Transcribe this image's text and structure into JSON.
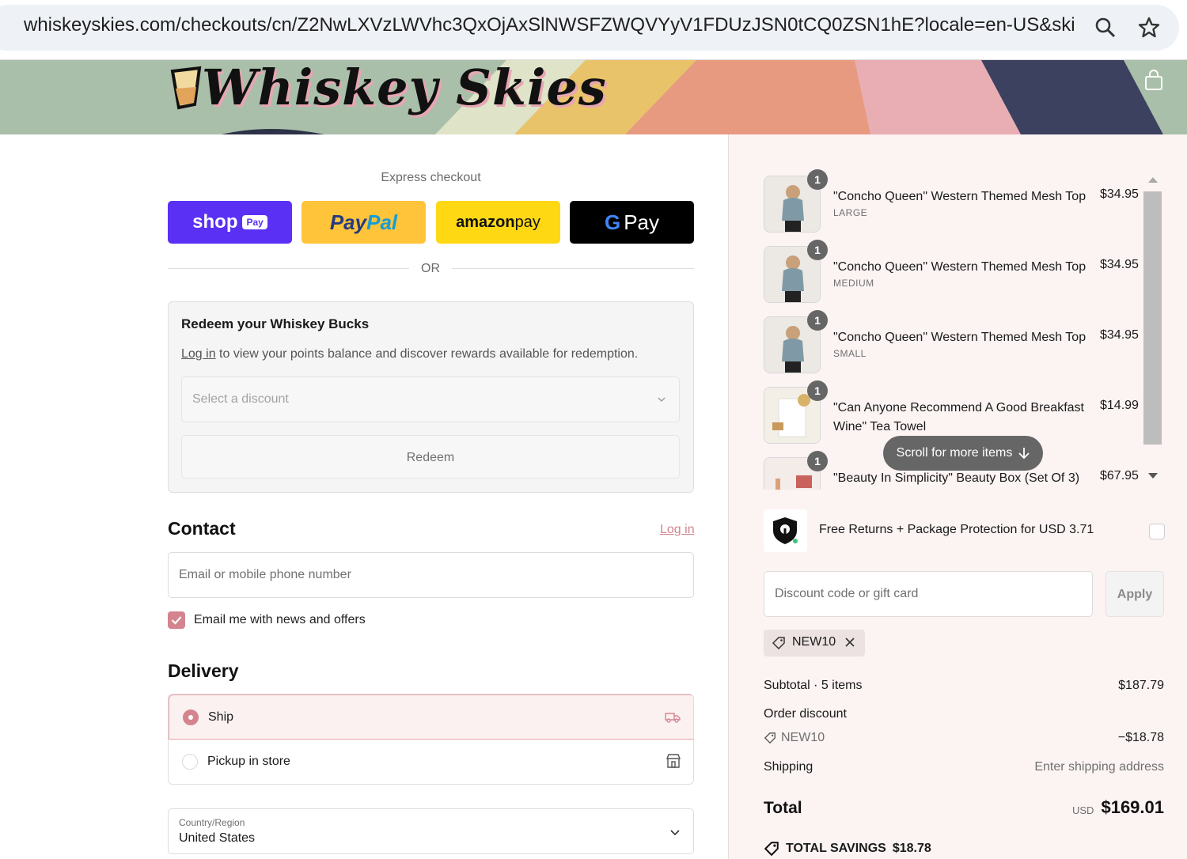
{
  "browser": {
    "url": "whiskeyskies.com/checkouts/cn/Z2NwLXVzLWVhc3QxOjAxSlNWSFZWQVYyV1FDUzJSN0tCQ0ZSN1hE?locale=en-US&skip_s...",
    "edge_char": "s"
  },
  "brand": {
    "name": "Whiskey Skies"
  },
  "express": {
    "title": "Express checkout",
    "shop_label": "shop",
    "shop_tag": "Pay",
    "paypal_a": "Pay",
    "paypal_b": "Pal",
    "amazon_a": "amazon",
    "amazon_b": " pay",
    "gpay_g": "G",
    "gpay_label": "Pay",
    "or": "OR"
  },
  "redeem": {
    "title": "Redeem your Whiskey Bucks",
    "login_link": "Log in",
    "desc": " to view your points balance and discover rewards available for redemption.",
    "select_placeholder": "Select a discount",
    "button": "Redeem"
  },
  "contact": {
    "title": "Contact",
    "login": "Log in",
    "email_placeholder": "Email or mobile phone number",
    "newsletter_label": "Email me with news and offers",
    "newsletter_checked": true
  },
  "delivery": {
    "title": "Delivery",
    "options": [
      {
        "label": "Ship",
        "selected": true
      },
      {
        "label": "Pickup in store",
        "selected": false
      }
    ],
    "country_label": "Country/Region",
    "country_value": "United States"
  },
  "cart": {
    "items": [
      {
        "qty": "1",
        "name": "\"Concho Queen\" Western Themed Mesh Top",
        "variant": "LARGE",
        "price": "$34.95"
      },
      {
        "qty": "1",
        "name": "\"Concho Queen\" Western Themed Mesh Top",
        "variant": "MEDIUM",
        "price": "$34.95"
      },
      {
        "qty": "1",
        "name": "\"Concho Queen\" Western Themed Mesh Top",
        "variant": "SMALL",
        "price": "$34.95"
      },
      {
        "qty": "1",
        "name": "\"Can Anyone Recommend A Good Breakfast Wine\" Tea Towel",
        "variant": "",
        "price": "$14.99"
      },
      {
        "qty": "1",
        "name": "\"Beauty In Simplicity\" Beauty Box (Set Of 3)",
        "variant": "",
        "price": "$67.95"
      }
    ],
    "scroll_hint": "Scroll for more items"
  },
  "protection": {
    "label": "Free Returns + Package Protection for USD 3.71",
    "checked": false
  },
  "discount": {
    "placeholder": "Discount code or gift card",
    "apply": "Apply",
    "applied_code": "NEW10"
  },
  "summary": {
    "subtotal_label": "Subtotal · 5 items",
    "subtotal_value": "$187.79",
    "order_discount_label": "Order discount",
    "discount_code": "NEW10",
    "discount_value": "−$18.78",
    "shipping_label": "Shipping",
    "shipping_value": "Enter shipping address",
    "total_label": "Total",
    "currency": "USD",
    "total_value": "$169.01",
    "savings_label": "TOTAL SAVINGS",
    "savings_value": "$18.78"
  },
  "colors": {
    "accent": "#d4848e",
    "shop_pay": "#5a31f4",
    "paypal": "#ffc439",
    "amazon": "#ffd814",
    "gpay": "#000000",
    "summary_bg": "#fcf3f3"
  }
}
